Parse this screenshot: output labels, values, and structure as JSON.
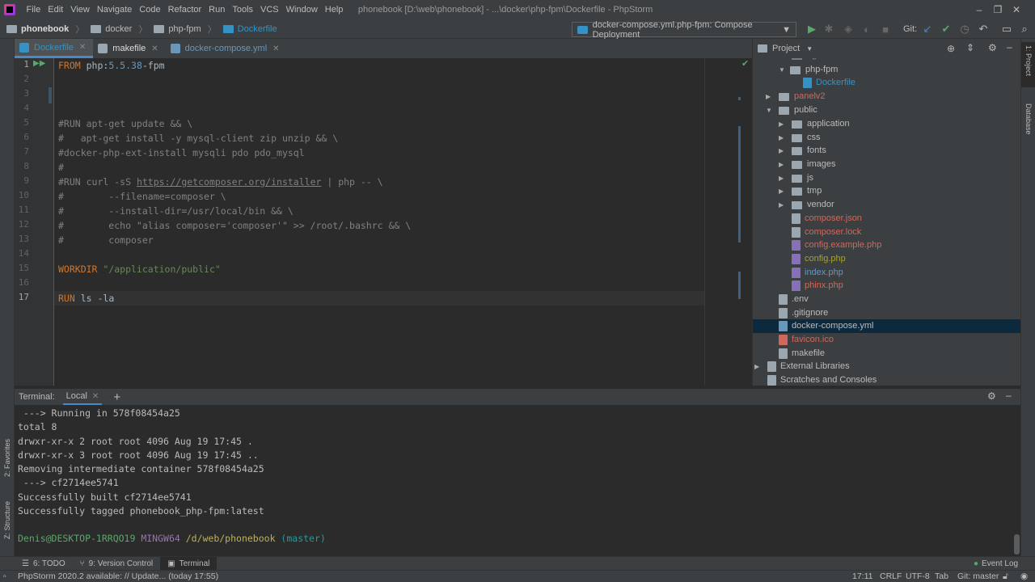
{
  "menubar": {
    "items": [
      "File",
      "Edit",
      "View",
      "Navigate",
      "Code",
      "Refactor",
      "Run",
      "Tools",
      "VCS",
      "Window",
      "Help"
    ],
    "title": "phonebook [D:\\web\\phonebook] - ...\\docker\\php-fpm\\Dockerfile - PhpStorm"
  },
  "breadcrumb": [
    "phonebook",
    "docker",
    "php-fpm",
    "Dockerfile"
  ],
  "run_config": "docker-compose.yml.php-fpm: Compose Deployment",
  "git_label": "Git:",
  "tabs": [
    {
      "label": "Dockerfile",
      "color": "#3592c4"
    },
    {
      "label": "makefile",
      "color": "#9aa7b0"
    },
    {
      "label": "docker-compose.yml",
      "color": "#6897bb"
    }
  ],
  "editor": {
    "line_numbers": [
      "1",
      "2",
      "3",
      "4",
      "5",
      "6",
      "7",
      "8",
      "9",
      "10",
      "11",
      "12",
      "13",
      "14",
      "15",
      "16",
      "17"
    ],
    "lines": {
      "l1_kw": "FROM ",
      "l1_txt": "php:",
      "l1_num": "5.5.38",
      "l1_rest": "-fpm",
      "l5": "#RUN apt-get update && \\",
      "l6": "#   apt-get install -y mysql-client zip unzip && \\",
      "l7": "#docker-php-ext-install mysqli pdo pdo_mysql",
      "l8": "#",
      "l9_a": "#RUN curl -sS ",
      "l9_link": "https://getcomposer.org/installer",
      "l9_b": " | php -- \\",
      "l10": "#        --filename=composer \\",
      "l11": "#        --install-dir=/usr/local/bin && \\",
      "l12": "#        echo \"alias composer='composer'\" >> /root/.bashrc && \\",
      "l13": "#        composer",
      "l15_kw": "WORKDIR ",
      "l15_str": "\"/application/public\"",
      "l17_kw": "RUN ",
      "l17_txt": "ls -la"
    }
  },
  "project": {
    "title": "Project",
    "tree": [
      {
        "label": "nginx",
        "type": "folder",
        "depth": 2
      },
      {
        "label": "php-fpm",
        "type": "folder",
        "depth": 2
      },
      {
        "label": "Dockerfile",
        "type": "file",
        "depth": 3,
        "color": "#3592c4"
      },
      {
        "label": "panelv2",
        "type": "folder",
        "depth": 1,
        "color": "#d1675a"
      },
      {
        "label": "public",
        "type": "folder",
        "depth": 1
      },
      {
        "label": "application",
        "type": "folder",
        "depth": 2
      },
      {
        "label": "css",
        "type": "folder",
        "depth": 2
      },
      {
        "label": "fonts",
        "type": "folder",
        "depth": 2
      },
      {
        "label": "images",
        "type": "folder",
        "depth": 2
      },
      {
        "label": "js",
        "type": "folder",
        "depth": 2
      },
      {
        "label": "tmp",
        "type": "folder",
        "depth": 2
      },
      {
        "label": "vendor",
        "type": "folder",
        "depth": 2
      },
      {
        "label": "composer.json",
        "type": "file",
        "depth": 2,
        "color": "#d1675a"
      },
      {
        "label": "composer.lock",
        "type": "file",
        "depth": 2,
        "color": "#d1675a"
      },
      {
        "label": "config.example.php",
        "type": "file",
        "depth": 2,
        "color": "#d1675a"
      },
      {
        "label": "config.php",
        "type": "file",
        "depth": 2,
        "color": "#a4a32d"
      },
      {
        "label": "index.php",
        "type": "file",
        "depth": 2,
        "color": "#6897bb"
      },
      {
        "label": "phinx.php",
        "type": "file",
        "depth": 2,
        "color": "#d1675a"
      },
      {
        "label": ".env",
        "type": "file",
        "depth": 1,
        "color": "#bbbbbb"
      },
      {
        "label": ".gitignore",
        "type": "file",
        "depth": 1,
        "color": "#bbbbbb"
      },
      {
        "label": "docker-compose.yml",
        "type": "file",
        "depth": 1,
        "color": "#bbbbbb"
      },
      {
        "label": "favicon.ico",
        "type": "file",
        "depth": 1,
        "color": "#d1675a"
      },
      {
        "label": "makefile",
        "type": "file",
        "depth": 1,
        "color": "#bbbbbb"
      },
      {
        "label": "External Libraries",
        "type": "lib",
        "depth": 0
      },
      {
        "label": "Scratches and Consoles",
        "type": "scratch",
        "depth": 0
      }
    ]
  },
  "side": {
    "project": "1: Project",
    "database": "Database",
    "favorites": "2: Favorites",
    "structure": "Z: Structure"
  },
  "terminal": {
    "label": "Terminal:",
    "tab": "Local",
    "lines": [
      " ---> Running in 578f08454a25",
      "total 8",
      "drwxr-xr-x 2 root root 4096 Aug 19 17:45 .",
      "drwxr-xr-x 3 root root 4096 Aug 19 17:45 ..",
      "Removing intermediate container 578f08454a25",
      " ---> cf2714ee5741",
      "Successfully built cf2714ee5741",
      "Successfully tagged phonebook_php-fpm:latest"
    ],
    "prompt_user": "Denis@DESKTOP-1RRQO19",
    "prompt_sys": " MINGW64",
    "prompt_path": " /d/web/phonebook",
    "prompt_branch": " (master)"
  },
  "bottom_tabs": [
    "6: TODO",
    "9: Version Control",
    "Terminal"
  ],
  "event_log": "Event Log",
  "status": {
    "message": "PhpStorm 2020.2 available: // Update... (today 17:55)",
    "position": "17:11",
    "line_sep": "CRLF",
    "encoding": "UTF-8",
    "indent": "Tab",
    "git": "Git: master"
  }
}
